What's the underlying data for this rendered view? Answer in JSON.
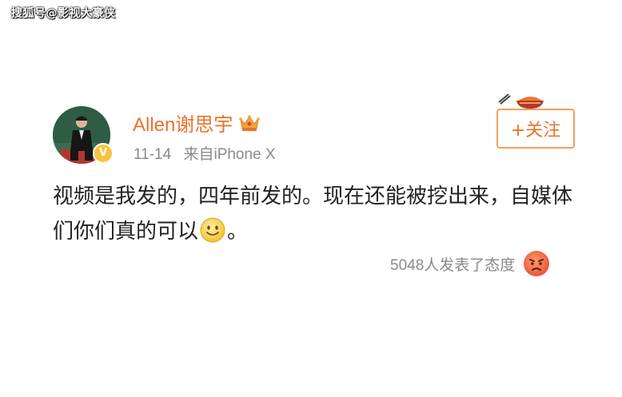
{
  "watermark": "搜狐号@影视大豪侠",
  "user": {
    "name": "Allen谢思宇",
    "crown_icon": "crown-icon",
    "verified_icon": "verified-v-icon",
    "verified_glyph": "V"
  },
  "post": {
    "date": "11-14",
    "source": "来自iPhone X",
    "text_part1": "视频是我发的，四年前发的。现在还能被挖出来，自媒体们你们真的可以",
    "text_part2": "。",
    "emoji_icon": "smile-emoji-icon"
  },
  "follow_button": {
    "label": "+关注"
  },
  "reactions": {
    "count_text": "5048人发表了态度",
    "icon": "angry-emoji-icon"
  },
  "colors": {
    "accent": "#e8732b",
    "meta_gray": "#8a8a8a",
    "text": "#222222"
  }
}
